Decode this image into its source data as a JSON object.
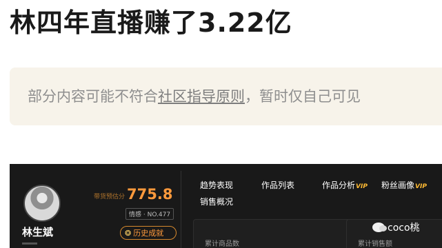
{
  "headline": "林四年直播赚了3.22亿",
  "notice": {
    "prefix": "部分内容可能不符合",
    "link": "社区指导原则",
    "suffix": "，暂时仅自己可见"
  },
  "dashboard": {
    "streamer_name": "林生斌",
    "score_label": "带货预估分",
    "score_value": "775.8",
    "rank_label": "情感 · NO.477",
    "history_button": "历史成就",
    "tabs": [
      "趋势表现",
      "作品列表",
      "作品分析",
      "粉丝画像"
    ],
    "vip_label": "VIP",
    "subtab": "销售概况",
    "cards": [
      "累计商品数",
      "累计销售额"
    ]
  },
  "watermark": "coco桃"
}
